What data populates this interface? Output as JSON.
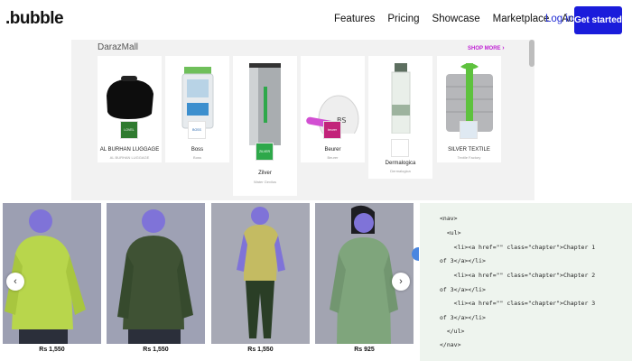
{
  "nav": {
    "logo": ".bubble",
    "links": [
      "Features",
      "Pricing",
      "Showcase",
      "Marketplace",
      "Academy"
    ],
    "login": "Log in",
    "cta": "Get started"
  },
  "mall": {
    "title": "DarazMall",
    "more": "SHOP MORE",
    "more_icon": "chevron-right-icon",
    "cards": [
      {
        "name": "AL BURHAN LUGGAGE",
        "sub": "AL BURHAN LUGGAGE",
        "badge": "LOVEL"
      },
      {
        "name": "Boss",
        "sub": "Boss",
        "badge": "BOSS"
      },
      {
        "name": "Zilver",
        "sub": "Water Gevilus",
        "badge": "ZILVER"
      },
      {
        "name": "Beurer",
        "sub": "Beurer",
        "badge": "beurer"
      },
      {
        "name": "Dermalogica",
        "sub": "Dermalogica",
        "badge": ""
      },
      {
        "name": "SILVER TEXTILE",
        "sub": "Textile Factory",
        "badge": ""
      }
    ]
  },
  "products": [
    {
      "price": "Rs 1,550"
    },
    {
      "price": "Rs 1,550"
    },
    {
      "price": "Rs 1,550"
    },
    {
      "price": "Rs 925"
    }
  ],
  "carousel": {
    "prev_icon": "chevron-left-icon",
    "next_icon": "chevron-right-icon"
  },
  "code_lines": [
    "<nav>",
    "  <ul>",
    "    <li><a href=\"\" class=\"chapter\">Chapter 1",
    "of 3</a></li>",
    "    <li><a href=\"\" class=\"chapter\">Chapter 2",
    "of 3</a></li>",
    "    <li><a href=\"\" class=\"chapter\">Chapter 3",
    "of 3</a></li>",
    "  </ul>",
    "</nav>"
  ],
  "colors": {
    "accent": "#1a1cdb",
    "mall_more": "#c024d4",
    "code_bg": "#eef4ee"
  }
}
